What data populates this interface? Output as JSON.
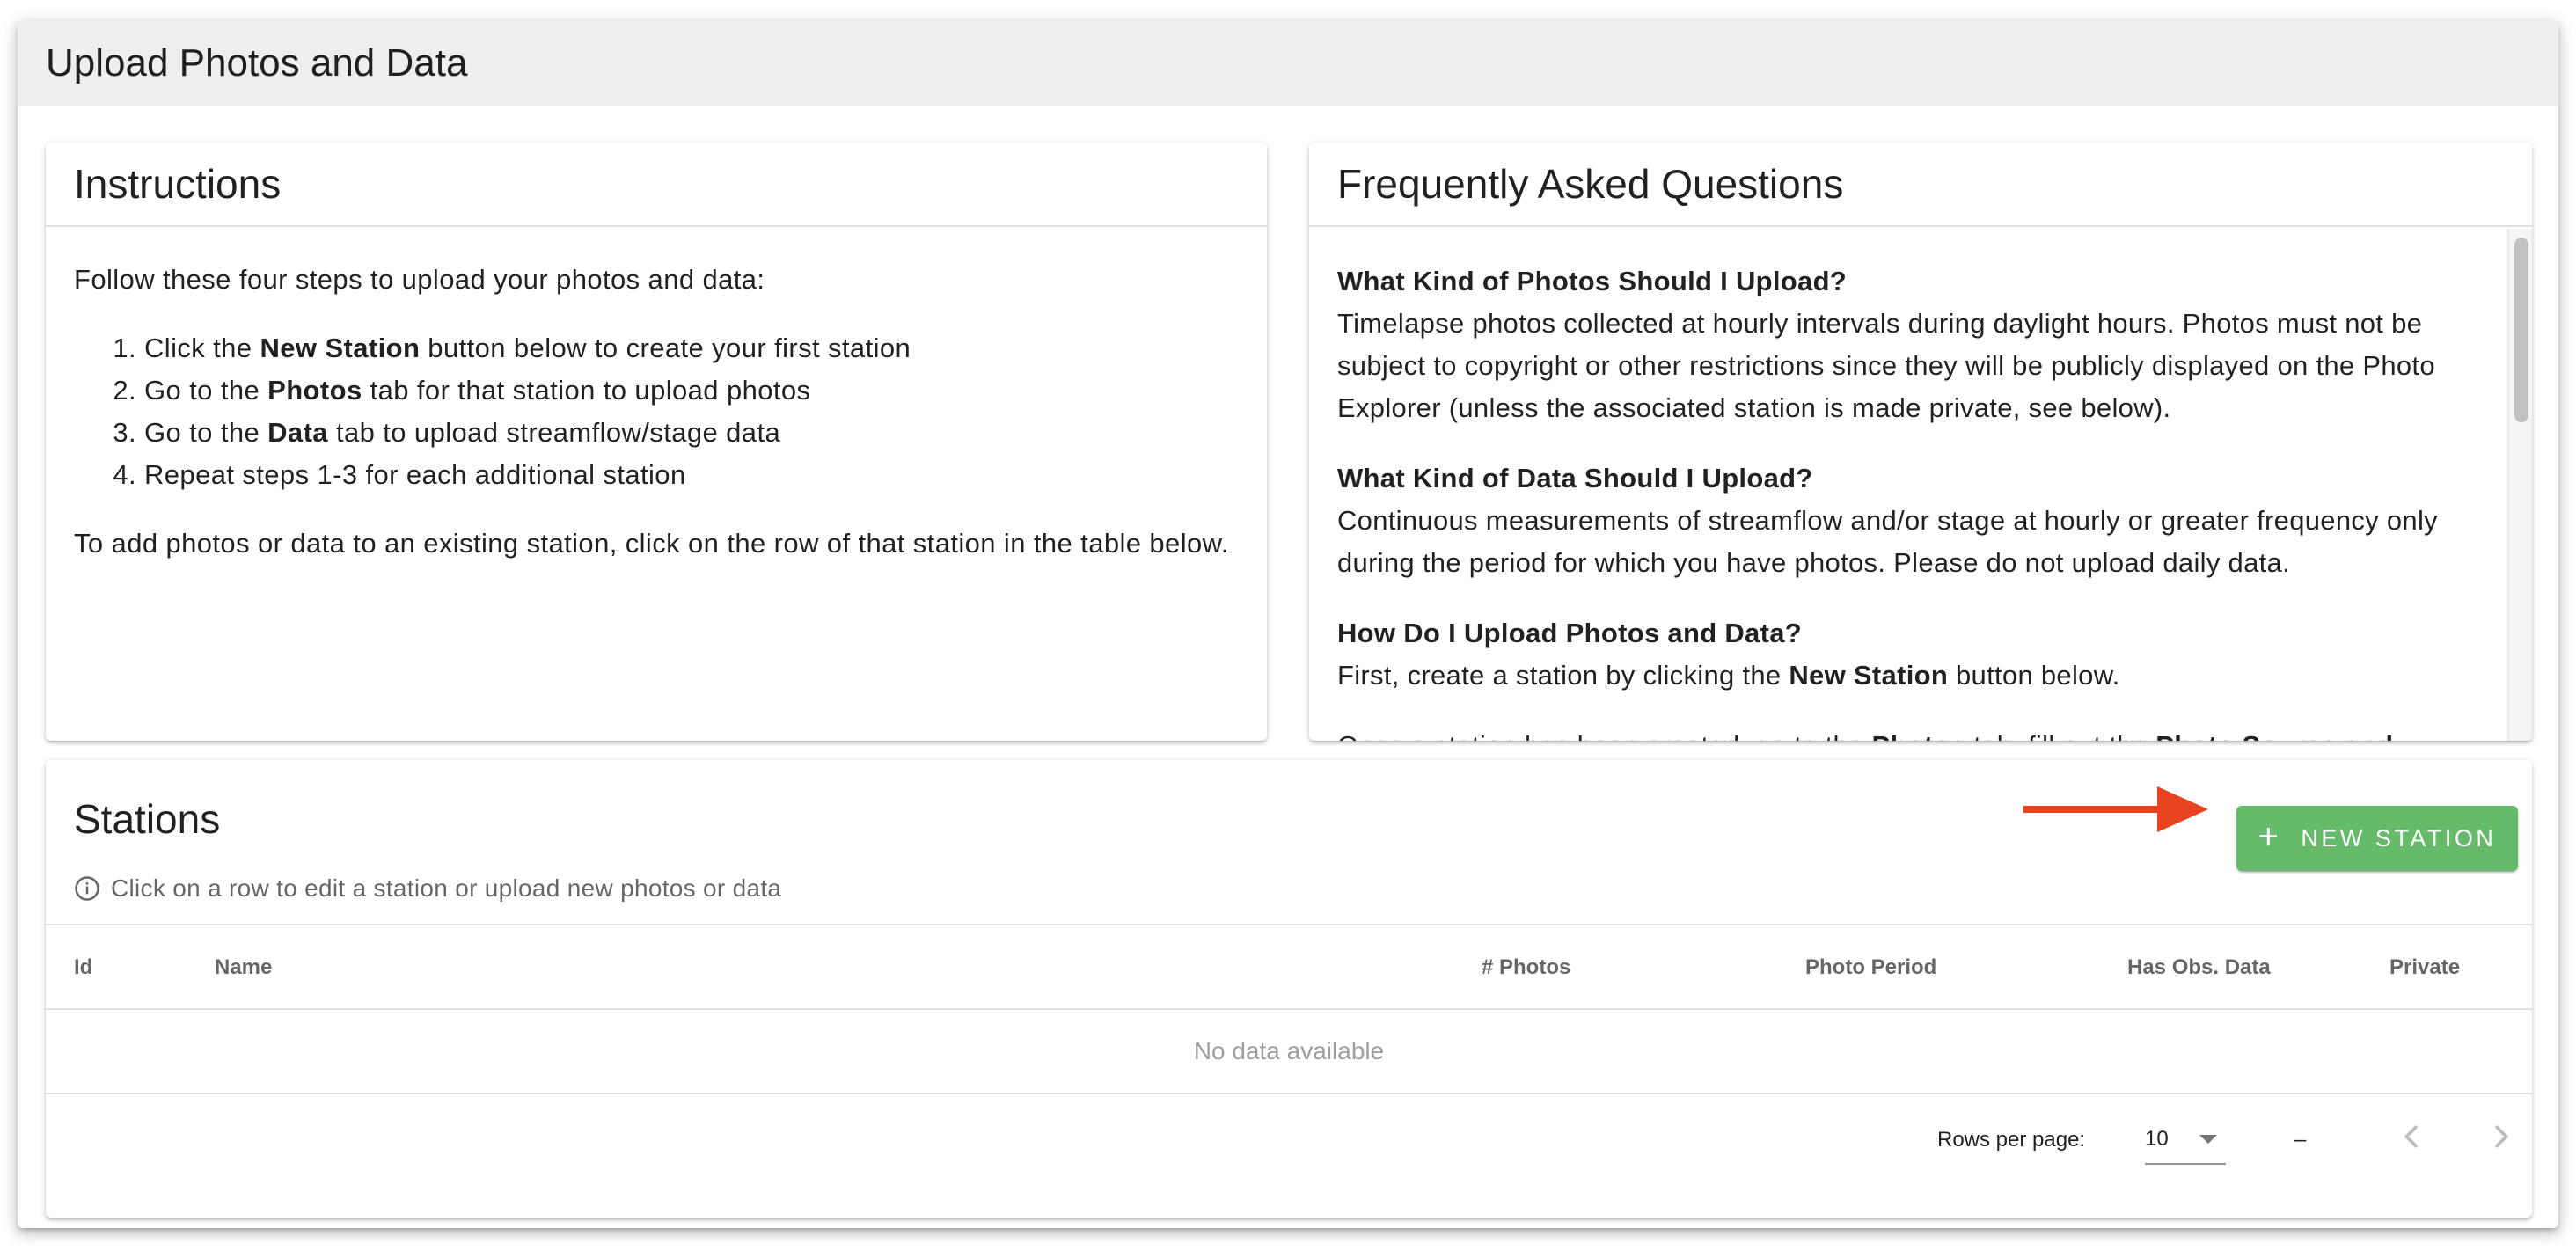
{
  "page": {
    "title": "Upload Photos and Data"
  },
  "instructions": {
    "title": "Instructions",
    "intro": "Follow these four steps to upload your photos and data:",
    "steps": [
      {
        "pre": "Click the ",
        "bold": "New Station",
        "post": " button below to create your first station"
      },
      {
        "pre": "Go to the ",
        "bold": "Photos",
        "post": " tab for that station to upload photos"
      },
      {
        "pre": "Go to the ",
        "bold": "Data",
        "post": " tab to upload streamflow/stage data"
      },
      {
        "pre": "Repeat steps 1-3 for each additional station",
        "bold": "",
        "post": ""
      }
    ],
    "outro": "To add photos or data to an existing station, click on the row of that station in the table below."
  },
  "faq": {
    "title": "Frequently Asked Questions",
    "items": [
      {
        "question": "What Kind of Photos Should I Upload?",
        "answer": "Timelapse photos collected at hourly intervals during daylight hours. Photos must not be subject to copyright or other restrictions since they will be publicly displayed on the Photo Explorer (unless the associated station is made private, see below)."
      },
      {
        "question": "What Kind of Data Should I Upload?",
        "answer": "Continuous measurements of streamflow and/or stage at hourly or greater frequency only during the period for which you have photos. Please do not upload daily data."
      },
      {
        "question": "How Do I Upload Photos and Data?",
        "answer_pre": "First, create a station by clicking the ",
        "answer_bold": "New Station",
        "answer_post": " button below."
      }
    ],
    "cutoff_line": {
      "pre": "Once a station has been created, go to the ",
      "bold1": "Photos",
      "mid": " tab, fill out the ",
      "bold2": "Photo Source and"
    }
  },
  "stations": {
    "title": "Stations",
    "new_button_label": "NEW STATION",
    "hint": "Click on a row to edit a station or upload new photos or data",
    "columns": [
      "Id",
      "Name",
      "# Photos",
      "Photo Period",
      "Has Obs. Data",
      "Private"
    ],
    "empty_text": "No data available",
    "footer": {
      "rows_per_page_label": "Rows per page:",
      "rows_per_page_value": "10",
      "range_text": "–"
    }
  },
  "colors": {
    "button_green": "#66bb6a",
    "arrow_red": "#e8441f",
    "header_bg": "#eeeeee"
  },
  "icons": {
    "plus": "plus-icon",
    "info": "info-circle-icon",
    "dropdown": "caret-down-icon",
    "prev": "chevron-left-icon",
    "next": "chevron-right-icon"
  }
}
